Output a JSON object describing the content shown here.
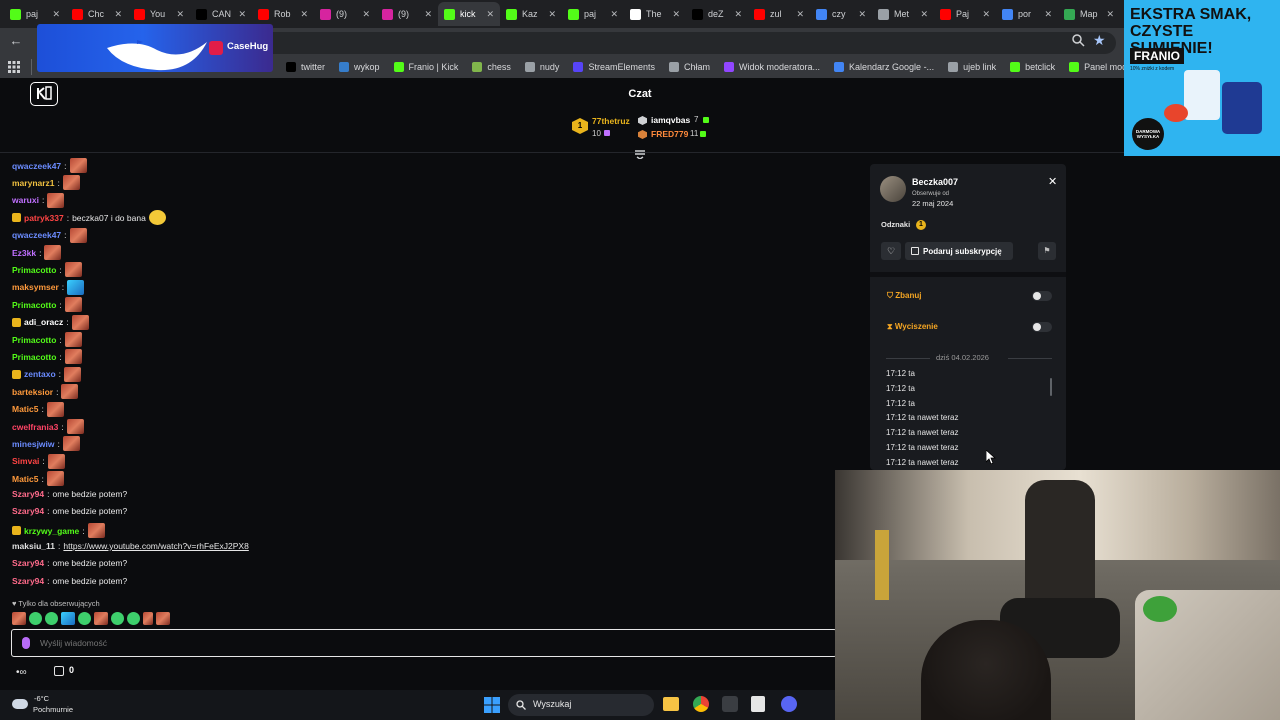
{
  "browser": {
    "tabs": [
      {
        "icon": "kick-icon",
        "color": "#53fc18",
        "title": "paj"
      },
      {
        "icon": "youtube-icon",
        "color": "#ff0000",
        "title": "Chc"
      },
      {
        "icon": "youtube-icon",
        "color": "#ff0000",
        "title": "You"
      },
      {
        "icon": "x-icon",
        "color": "#000000",
        "title": "CAN"
      },
      {
        "icon": "youtube-icon",
        "color": "#ff0000",
        "title": "Rob"
      },
      {
        "icon": "instagram-icon",
        "color": "#d6249f",
        "title": "(9)"
      },
      {
        "icon": "instagram-icon",
        "color": "#d6249f",
        "title": "(9)"
      },
      {
        "icon": "kick-icon",
        "color": "#53fc18",
        "title": "kick",
        "active": true
      },
      {
        "icon": "kick-icon",
        "color": "#53fc18",
        "title": "Kaz"
      },
      {
        "icon": "kick-icon",
        "color": "#53fc18",
        "title": "paj"
      },
      {
        "icon": "diamond-icon",
        "color": "#ffffff",
        "title": "The"
      },
      {
        "icon": "x-icon",
        "color": "#000000",
        "title": "deZ"
      },
      {
        "icon": "youtube-icon",
        "color": "#ff0000",
        "title": "zul"
      },
      {
        "icon": "google-icon",
        "color": "#4285f4",
        "title": "czy"
      },
      {
        "icon": "globe-icon",
        "color": "#9aa0a6",
        "title": "Met"
      },
      {
        "icon": "youtube-icon",
        "color": "#ff0000",
        "title": "Paj"
      },
      {
        "icon": "google-icon",
        "color": "#4285f4",
        "title": "por"
      },
      {
        "icon": "maps-icon",
        "color": "#34a853",
        "title": "Map"
      }
    ],
    "bookmarks": [
      {
        "icon": "x-icon",
        "color": "#000000",
        "label": "twitter"
      },
      {
        "icon": "wykop-icon",
        "color": "#367dcb",
        "label": "wykop"
      },
      {
        "icon": "kick-icon",
        "color": "#53fc18",
        "label": "Franio | Kick"
      },
      {
        "icon": "chess-icon",
        "color": "#81b64c",
        "label": "chess"
      },
      {
        "icon": "folder-icon",
        "color": "#9aa0a6",
        "label": "nudy"
      },
      {
        "icon": "streamelements-icon",
        "color": "#5744f8",
        "label": "StreamElements"
      },
      {
        "icon": "globe-icon",
        "color": "#9aa0a6",
        "label": "Chłam"
      },
      {
        "icon": "twitch-icon",
        "color": "#9146ff",
        "label": "Widok moderatora..."
      },
      {
        "icon": "calendar-icon",
        "color": "#4285f4",
        "label": "Kalendarz Google -..."
      },
      {
        "icon": "globe-icon",
        "color": "#9aa0a6",
        "label": "ujeb link"
      },
      {
        "icon": "kick-icon",
        "color": "#53fc18",
        "label": "betclick"
      },
      {
        "icon": "kick-icon",
        "color": "#53fc18",
        "label": "Panel moderatora |..."
      }
    ]
  },
  "overlay": {
    "brand": "CaseHug"
  },
  "chat": {
    "title": "Czat",
    "leaderboard": {
      "first": {
        "name": "77thetruz",
        "count": "10"
      },
      "second": {
        "name": "iamqvbas",
        "count": "7"
      },
      "third": {
        "name": "FRED779",
        "count": "11"
      }
    },
    "messages": [
      {
        "user": "qwaczeek47",
        "color": "#6b8cff",
        "text": "",
        "emote": "red"
      },
      {
        "user": "marynarz1",
        "color": "#f0c040",
        "text": "",
        "emote": "red"
      },
      {
        "user": "waruxi",
        "color": "#c070ff",
        "text": "",
        "emote": "red"
      },
      {
        "user": "patryk337",
        "color": "#ff4444",
        "text": "beczka07 i do bana",
        "emote": "yellow",
        "badges": true
      },
      {
        "user": "qwaczeek47",
        "color": "#6b8cff",
        "text": "",
        "emote": "red"
      },
      {
        "user": "Ez3kk",
        "color": "#c070ff",
        "text": "",
        "emote": "red"
      },
      {
        "user": "Primacotto",
        "color": "#53fc18",
        "text": "",
        "emote": "red"
      },
      {
        "user": "maksymser",
        "color": "#ff9a3c",
        "text": "",
        "emote": "blue"
      },
      {
        "user": "Primacotto",
        "color": "#53fc18",
        "text": "",
        "emote": "red"
      },
      {
        "user": "adi_oracz",
        "color": "#ffffff",
        "text": "",
        "emote": "red",
        "badges": true
      },
      {
        "user": "Primacotto",
        "color": "#53fc18",
        "text": "",
        "emote": "red"
      },
      {
        "user": "Primacotto",
        "color": "#53fc18",
        "text": "",
        "emote": "red"
      },
      {
        "user": "zentaxo",
        "color": "#6b8cff",
        "text": "",
        "emote": "red",
        "badges": true
      },
      {
        "user": "barteksior",
        "color": "#ff9a3c",
        "text": "",
        "emote": "red"
      },
      {
        "user": "Matic5",
        "color": "#ff9a3c",
        "text": "",
        "emote": "red"
      },
      {
        "user": "cwelfrania3",
        "color": "#ff4466",
        "text": "",
        "emote": "red"
      },
      {
        "user": "minesjwiw",
        "color": "#6b8cff",
        "text": "",
        "emote": "red"
      },
      {
        "user": "Simvai",
        "color": "#ff4444",
        "text": "",
        "emote": "red"
      },
      {
        "user": "Matic5",
        "color": "#ff9a3c",
        "text": "",
        "emote": "red"
      },
      {
        "user": "Szary94",
        "color": "#ff6b8b",
        "text": "ome bedzie potem?",
        "emote": ""
      },
      {
        "user": "Szary94",
        "color": "#ff6b8b",
        "text": "ome bedzie potem?",
        "emote": ""
      },
      {
        "user": "krzywy_game",
        "color": "#53fc18",
        "text": "",
        "emote": "red",
        "badges": true
      },
      {
        "user": "maksiu_11",
        "color": "#e0e0e0",
        "text": "https://www.youtube.com/watch?v=rhFeExJ2PX8",
        "emote": "",
        "link": true
      },
      {
        "user": "Szary94",
        "color": "#ff6b8b",
        "text": "ome bedzie potem?",
        "emote": ""
      },
      {
        "user": "Szary94",
        "color": "#ff6b8b",
        "text": "ome bedzie potem?",
        "emote": ""
      }
    ],
    "followers_only": "Tylko dla obserwujących",
    "input_placeholder": "Wyślij wiadomość",
    "points": "0"
  },
  "user_card": {
    "username": "Beczka007",
    "follows_label": "Obserwuje od",
    "follows_date": "22 maj 2024",
    "badges_label": "Odznaki",
    "gift_button": "Podaruj subskrypcję",
    "ban_label": "Zbanuj",
    "timeout_label": "Wyciszenie",
    "date_divider": "dziś 04.02.2026",
    "history": [
      "17:12 ta",
      "17:12 ta",
      "17:12 ta",
      "17:12 ta nawet teraz",
      "17:12 ta nawet teraz",
      "17:12 ta nawet teraz",
      "17:12 ta nawet teraz"
    ]
  },
  "ad": {
    "headline": "EKSTRA SMAK, CZYSTE SUMIENIE!",
    "brand": "FRANIO",
    "sub": "10% zniżki z kodem",
    "badge": "DARMOWA WYSYŁKA"
  },
  "taskbar": {
    "temperature": "-6°C",
    "weather": "Pochmurnie",
    "search": "Wyszukaj"
  }
}
